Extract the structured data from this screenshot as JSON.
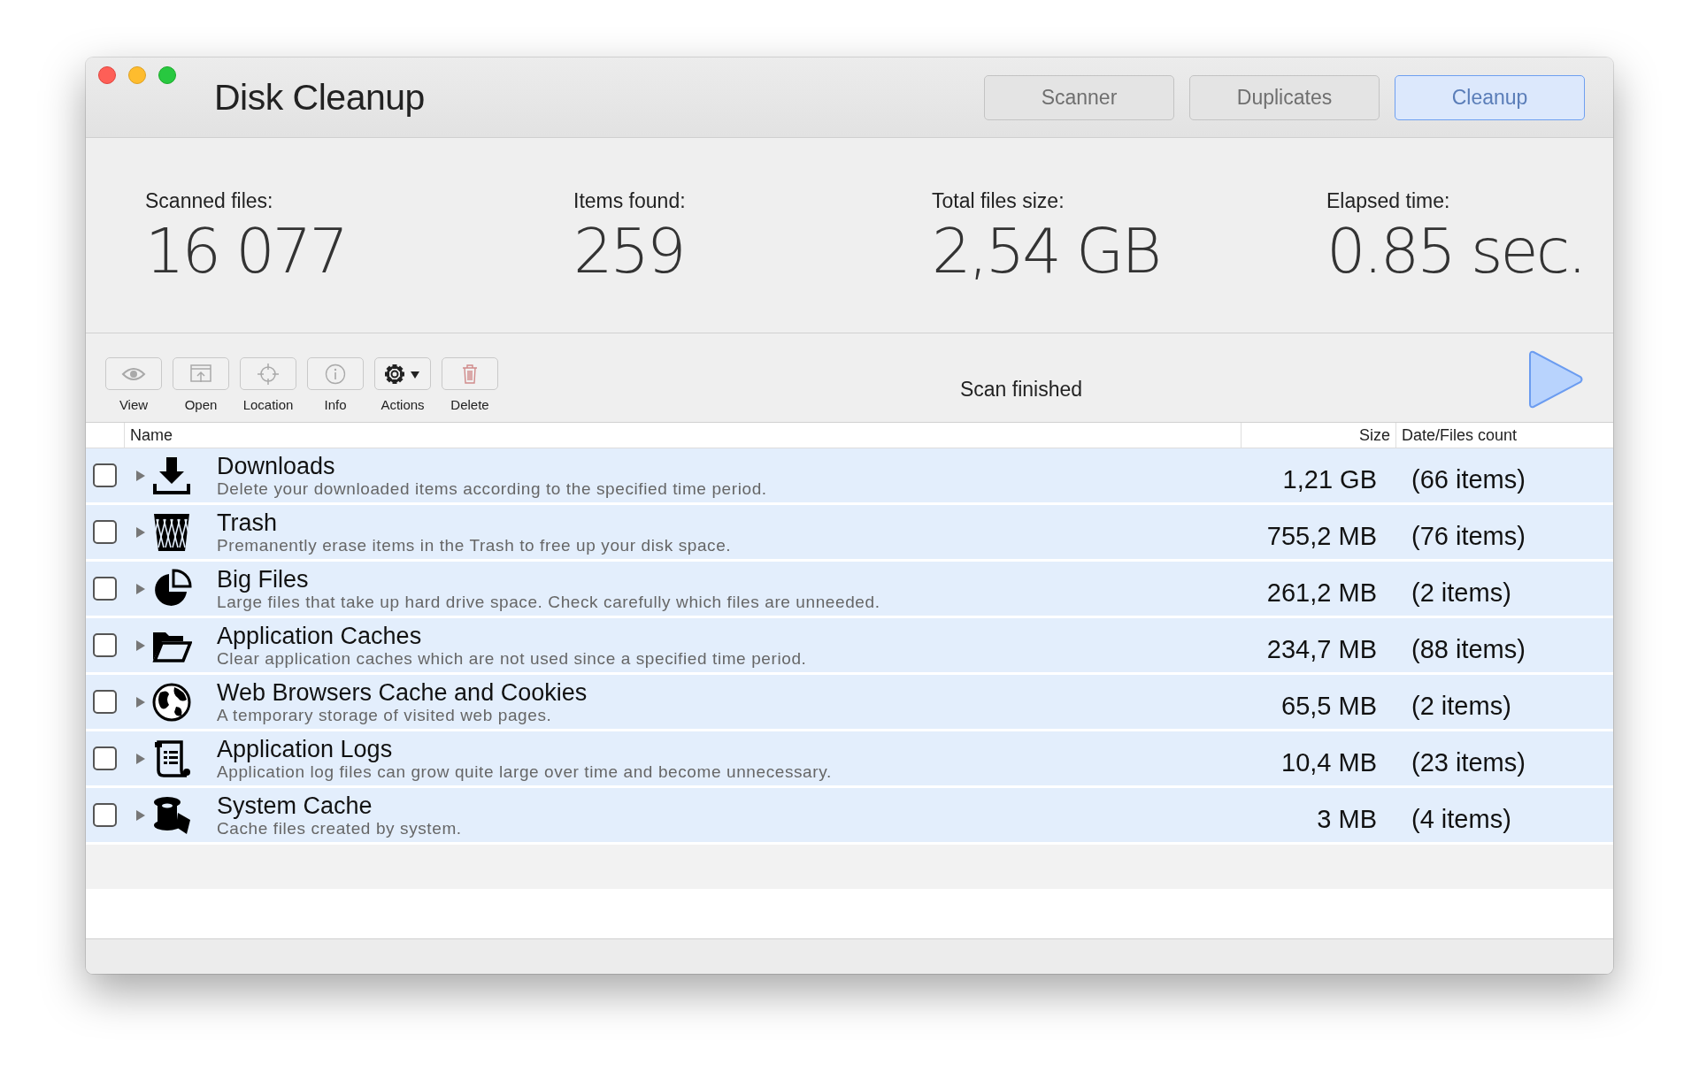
{
  "window": {
    "title": "Disk Cleanup"
  },
  "nav_tabs": [
    {
      "label": "Scanner",
      "selected": false
    },
    {
      "label": "Duplicates",
      "selected": false
    },
    {
      "label": "Cleanup",
      "selected": true
    }
  ],
  "stats": [
    {
      "label": "Scanned files:",
      "value": "16 077"
    },
    {
      "label": "Items found:",
      "value": "259"
    },
    {
      "label": "Total files size:",
      "value": "2,54 GB"
    },
    {
      "label": "Elapsed time:",
      "value": "0.85 sec."
    }
  ],
  "toolbar": [
    {
      "label": "View",
      "disabled": true
    },
    {
      "label": "Open",
      "disabled": true
    },
    {
      "label": "Location",
      "disabled": true
    },
    {
      "label": "Info",
      "disabled": true
    },
    {
      "label": "Actions",
      "disabled": false
    },
    {
      "label": "Delete",
      "disabled": true
    }
  ],
  "status": "Scan finished",
  "table": {
    "columns": [
      "Name",
      "Size",
      "Date/Files count"
    ],
    "rows": [
      {
        "title": "Downloads",
        "description": "Delete your downloaded items according to the specified time period.",
        "size": "1,21 GB",
        "count": "(66 items)",
        "checked": false,
        "expanded": false
      },
      {
        "title": "Trash",
        "description": "Premanently erase items in the Trash to free up your disk space.",
        "size": "755,2 MB",
        "count": "(76 items)",
        "checked": false,
        "expanded": false
      },
      {
        "title": "Big Files",
        "description": "Large files that take up hard drive space. Check carefully which files are unneeded.",
        "size": "261,2 MB",
        "count": "(2 items)",
        "checked": false,
        "expanded": false
      },
      {
        "title": "Application Caches",
        "description": "Clear application caches which are not used since a specified time period.",
        "size": "234,7 MB",
        "count": "(88 items)",
        "checked": false,
        "expanded": false
      },
      {
        "title": "Web Browsers Cache and Cookies",
        "description": "A temporary storage of visited web pages.",
        "size": "65,5 MB",
        "count": "(2 items)",
        "checked": false,
        "expanded": false
      },
      {
        "title": "Application Logs",
        "description": "Application log files can grow quite large over time and become unnecessary.",
        "size": "10,4 MB",
        "count": "(23 items)",
        "checked": false,
        "expanded": false
      },
      {
        "title": "System Cache",
        "description": "Cache files created by system.",
        "size": "3 MB",
        "count": "(4 items)",
        "checked": false,
        "expanded": false
      }
    ]
  }
}
